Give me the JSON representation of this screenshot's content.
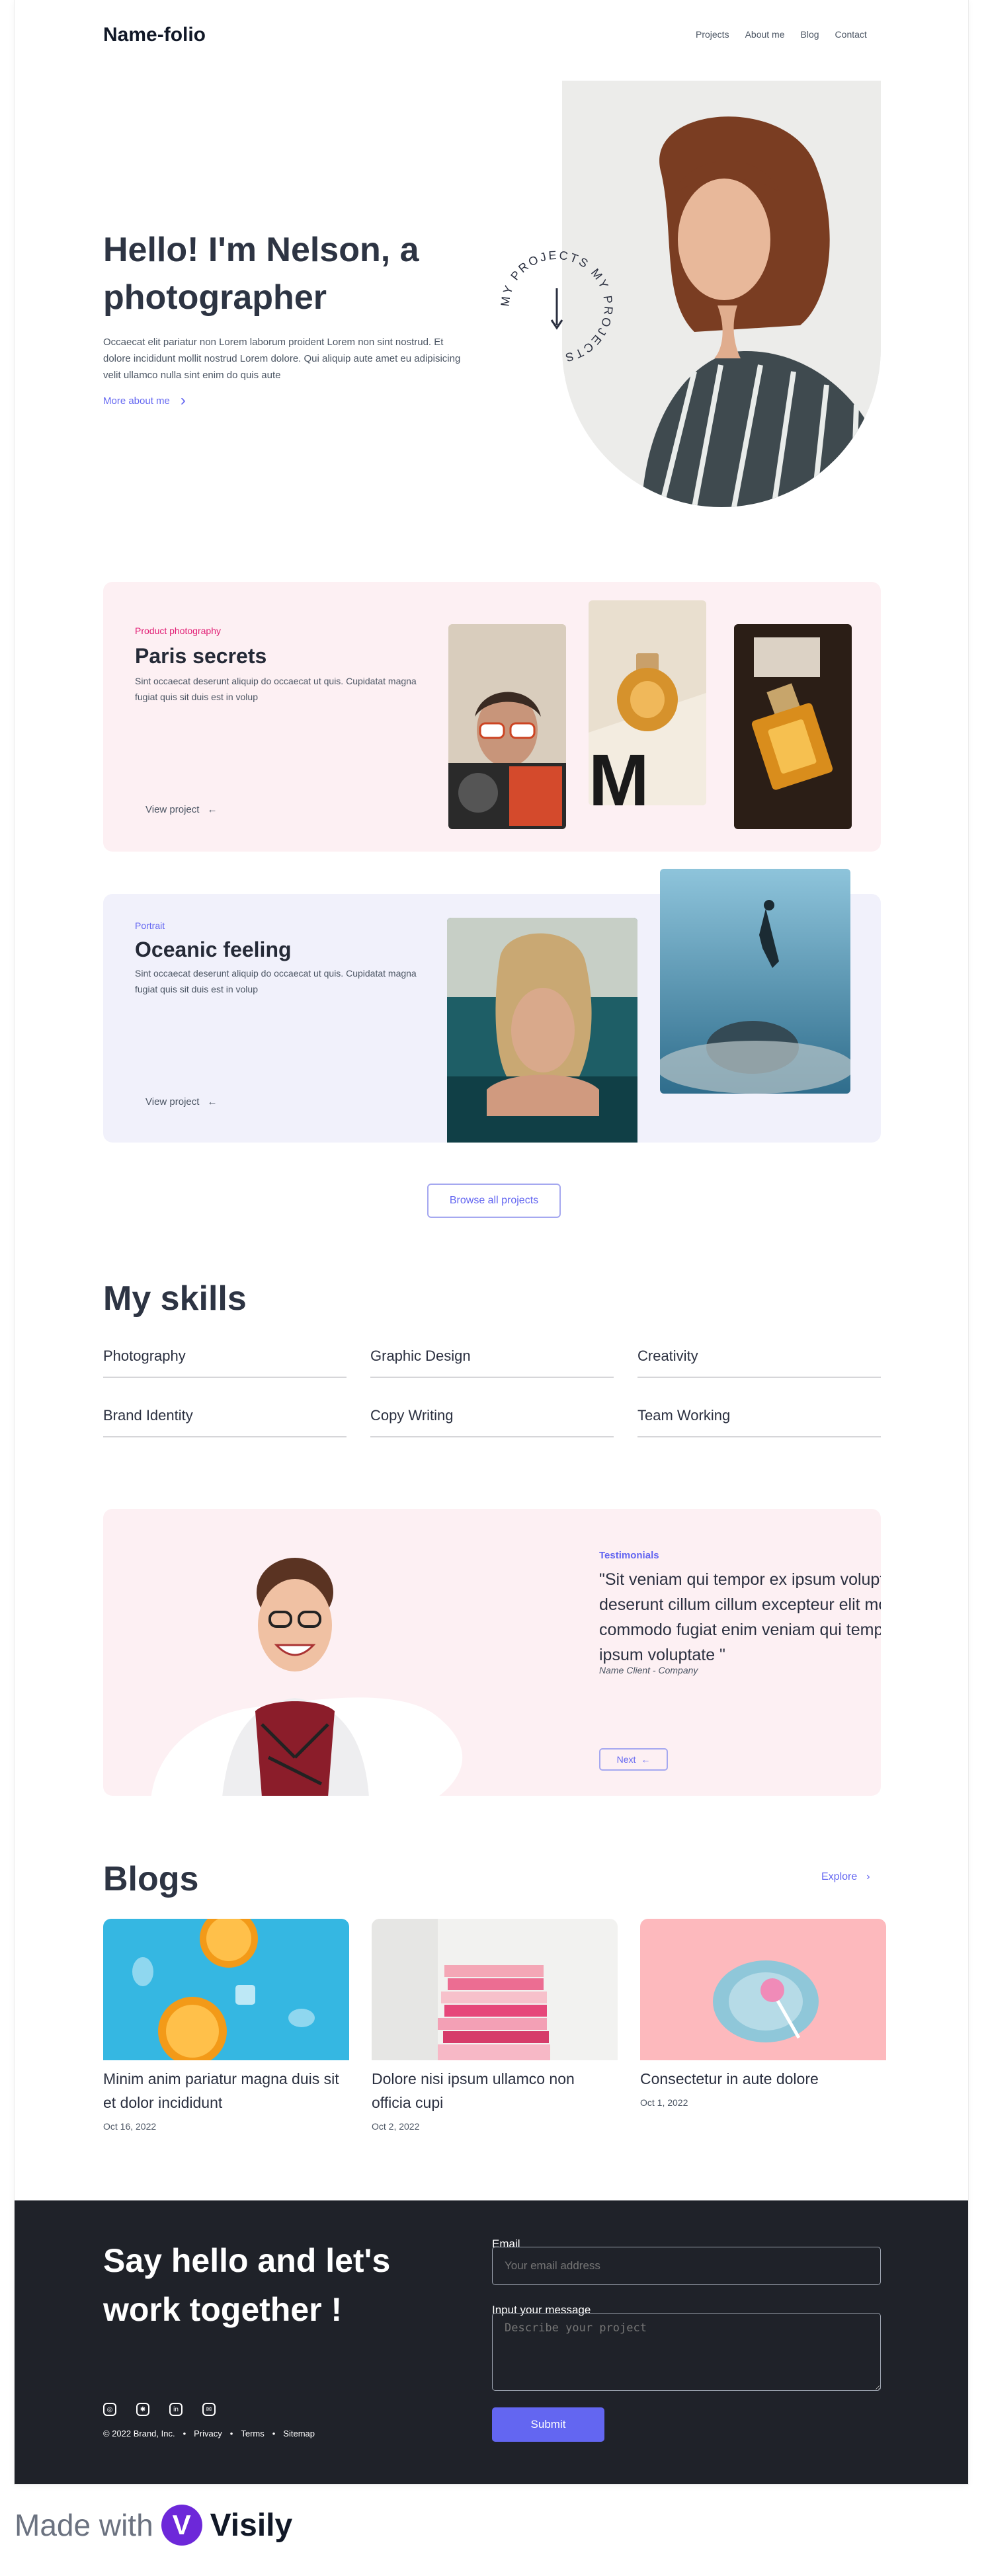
{
  "brand": {
    "logo": "Name-folio"
  },
  "nav": [
    "Projects",
    "About me",
    "Blog",
    "Contact"
  ],
  "hero": {
    "title": "Hello! I'm Nelson, a photographer",
    "text": "Occaecat elit pariatur non Lorem laborum proident Lorem non sint nostrud. Et dolore incididunt mollit nostrud Lorem dolore. Qui aliquip aute amet eu adipisicing velit ullamco nulla sint enim do quis aute",
    "more": "More about me",
    "badge": "MY PROJECTS MY PROJECTS"
  },
  "projects": [
    {
      "kicker": "Product photography",
      "title": "Paris secrets",
      "desc": "Sint occaecat deserunt aliquip do occaecat ut quis. Cupidatat magna fugiat quis sit duis est in volup",
      "link": "View project"
    },
    {
      "kicker": "Portrait",
      "title": "Oceanic feeling",
      "desc": "Sint occaecat deserunt aliquip do occaecat ut quis. Cupidatat magna fugiat quis sit duis est in volup",
      "link": "View project"
    }
  ],
  "browse": "Browse all projects",
  "skills": {
    "title": "My skills",
    "items": [
      "Photography",
      "Graphic Design",
      "Creativity",
      "Brand Identity",
      "Copy Writing",
      "Team Working"
    ]
  },
  "testimonial": {
    "kicker": "Testimonials",
    "quote": "\"Sit veniam qui tempor ex ipsum voluptate deserunt cillum cillum excepteur elit mollit commodo fugiat enim veniam qui tempor ex ipsum voluptate \"",
    "name": "Name Client -  Company",
    "next": "Next"
  },
  "blogs": {
    "title": "Blogs",
    "explore": "Explore",
    "items": [
      {
        "title": "Minim anim pariatur magna duis sit et dolor incididunt",
        "date": "Oct 16, 2022"
      },
      {
        "title": "Dolore nisi ipsum ullamco non officia cupi",
        "date": "Oct 2, 2022"
      },
      {
        "title": "Consectetur in aute dolore",
        "date": "Oct 1, 2022"
      }
    ]
  },
  "footer": {
    "title": "Say hello and let's work together !",
    "email_label": "Email",
    "email_placeholder": "Your email address",
    "message_label": "Input your message",
    "message_placeholder": "Describe your project",
    "submit": "Submit",
    "copyright": "© 2022 Brand, Inc.",
    "links": [
      "Privacy",
      "Terms",
      "Sitemap"
    ]
  },
  "made_with": {
    "text": "Made with",
    "brand": "Visily"
  },
  "colors": {
    "accent": "#6366f1",
    "pink": "#e11d74",
    "pink_bg": "#fdf0f3",
    "lavender_bg": "#f1f1fb",
    "footer_bg": "#1f2229"
  }
}
